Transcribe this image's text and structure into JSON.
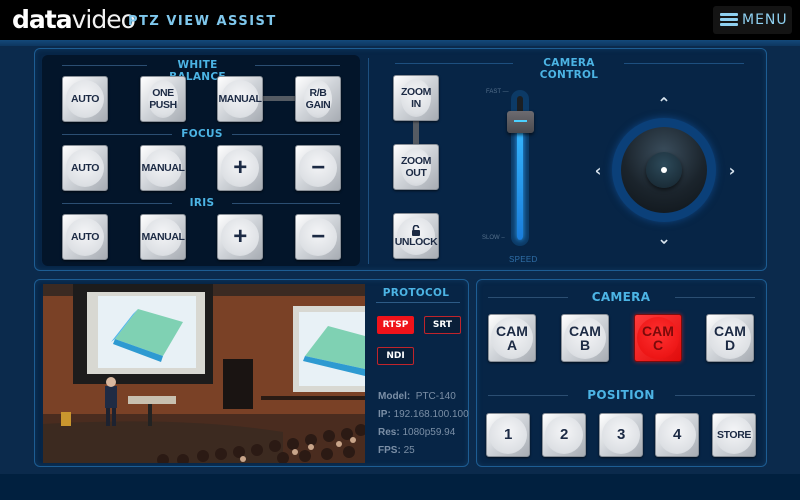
{
  "header": {
    "logo_bold": "data",
    "logo_thin": "video",
    "app_title": "PTZ VIEW ASSIST",
    "menu_label": "MENU",
    "menu_icon": "hamburger-icon"
  },
  "lens_controls": {
    "white_balance": {
      "title": "WHITE BALANCE",
      "buttons": [
        "AUTO",
        "ONE PUSH",
        "MANUAL",
        "R/B GAIN"
      ]
    },
    "focus": {
      "title": "FOCUS",
      "buttons": [
        "AUTO",
        "MANUAL",
        "+",
        "−"
      ]
    },
    "iris": {
      "title": "IRIS",
      "buttons": [
        "AUTO",
        "MANUAL",
        "+",
        "−"
      ]
    }
  },
  "camera_control": {
    "title": "CAMERA CONTROL",
    "zoom_in": "ZOOM IN",
    "zoom_out": "ZOOM OUT",
    "unlock": "UNLOCK",
    "unlock_icon": "unlock-icon",
    "speed": {
      "label": "SPEED",
      "max_label": "FAST",
      "min_label": "SLOW",
      "value_fraction": 0.82
    },
    "joystick": {
      "up_icon": "chevron-up-icon",
      "down_icon": "chevron-down-icon",
      "left_icon": "chevron-left-icon",
      "right_icon": "chevron-right-icon"
    }
  },
  "protocol": {
    "title": "PROTOCOL",
    "options": [
      {
        "label": "RTSP",
        "active": true
      },
      {
        "label": "SRT",
        "active": false
      },
      {
        "label": "NDI",
        "active": false
      }
    ],
    "info": {
      "model_label": "Model:",
      "model_value": "PTC-140",
      "ip_label": "IP:",
      "ip_value": "192.168.100.100",
      "res_label": "Res:",
      "res_value": "1080p59.94",
      "fps_label": "FPS:",
      "fps_value": "25"
    }
  },
  "camera_select": {
    "title": "CAMERA",
    "cameras": [
      {
        "line1": "CAM",
        "line2": "A",
        "active": false
      },
      {
        "line1": "CAM",
        "line2": "B",
        "active": false
      },
      {
        "line1": "CAM",
        "line2": "C",
        "active": true
      },
      {
        "line1": "CAM",
        "line2": "D",
        "active": false
      }
    ],
    "active_color": "#f0131a"
  },
  "position": {
    "title": "POSITION",
    "buttons": [
      "1",
      "2",
      "3",
      "4",
      "STORE"
    ]
  },
  "colors": {
    "accent": "#4cb4e4",
    "panel_bg": "#072546",
    "active_red": "#f0131a"
  }
}
